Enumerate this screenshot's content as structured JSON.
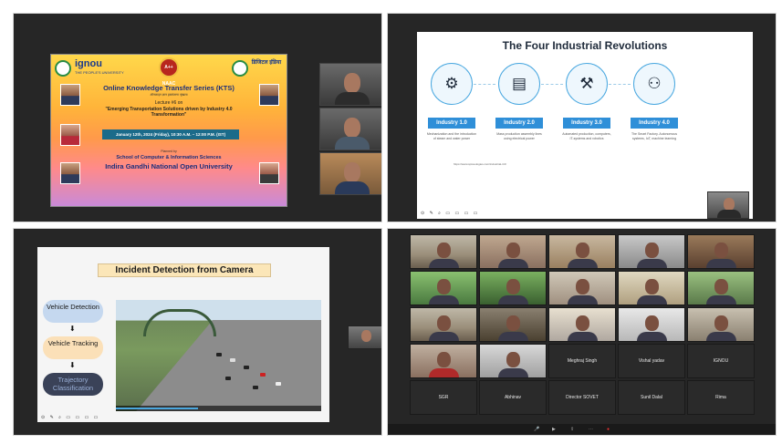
{
  "q1": {
    "poster": {
      "logo_left": "ignou",
      "logo_left_sub": "THE PEOPLE'S UNIVERSITY",
      "naac": "A++ NAAC",
      "logo_right": "डिजिटल इंडिया",
      "title": "Online Knowledge Transfer Series (KTS)",
      "subtitle": "ऑनलाइन ज्ञान हस्तांतरण श्रृंखला",
      "lecture": "Lecture #6 on",
      "topic": "\"Emerging Transportation Solutions driven by Industry 4.0 Transformation\"",
      "date": "January 12th, 2024 (Friday), 10:30 A.M. – 12:00 P.M. (IST)",
      "organised_by": "Planned by",
      "school": "School of Computer & Information Sciences",
      "university": "Indira Gandhi National Open University"
    }
  },
  "q2": {
    "title": "The Four Industrial Revolutions",
    "revolutions": [
      {
        "icon": "gears-icon",
        "glyph": "⚙",
        "badge": "Industry 1.0",
        "desc": "Mechanization and the introduction of steam and water power"
      },
      {
        "icon": "assembly-line-icon",
        "glyph": "▤",
        "badge": "Industry 2.0",
        "desc": "Mass production assembly lines using electrical power"
      },
      {
        "icon": "robot-arm-icon",
        "glyph": "⚒",
        "badge": "Industry 3.0",
        "desc": "Automated production, computers, IT-systems and robotics"
      },
      {
        "icon": "smart-factory-icon",
        "glyph": "⚇",
        "badge": "Industry 4.0",
        "desc": "The Smart Factory. Autonomous systems, IoT, machine learning"
      }
    ],
    "url": "https://www.spiceologies.com/industrial-4.0/"
  },
  "q3": {
    "title": "Incident Detection from Camera",
    "steps": [
      "Vehicle Detection",
      "Vehicle Tracking",
      "Trajectory Classification"
    ],
    "step_colors": [
      "#c5d8ef",
      "#fbe0b8",
      "#3a4258"
    ]
  },
  "q4": {
    "named_tiles": [
      "Meghraj Singh",
      "Vishal yadav",
      "IGNOU",
      "SGR",
      "Abhinav",
      "Director SOVET",
      "Sunil Dalal",
      "Rima"
    ]
  }
}
